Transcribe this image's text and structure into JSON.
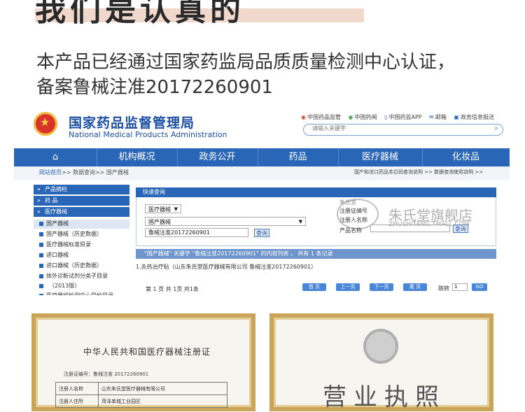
{
  "headline": "我们是认真的",
  "description": {
    "line1": "本产品已经通过国家药监局品质质量检测中心认证，",
    "line2": "备案鲁械注准20172260901"
  },
  "agency": {
    "name_cn": "国家药品监督管理局",
    "name_en": "National Medical Products Administration",
    "top_links": [
      "中国药品监管",
      "中国药闻",
      "中国药监APP",
      "邮箱",
      "政务信息报送"
    ],
    "search_placeholder": "请输入关键字"
  },
  "nav": {
    "items": [
      "机构概况",
      "政务公开",
      "药品",
      "医疗器械",
      "化妆品"
    ]
  },
  "breadcrumb": {
    "home": "网站首页",
    "rest": ">> 数据查询>> 国产器械"
  },
  "subnav_right": "国产和进口药品本位码查询说明 >>    数据查询使用说明 >>",
  "sidebar": {
    "heads": [
      "产品摘检",
      "药    品",
      "医疗器械"
    ],
    "items": [
      {
        "label": "国产器械",
        "active": true
      },
      {
        "label": "国产器械（历史数据）",
        "active": false
      },
      {
        "label": "医疗器械标准目录",
        "active": false
      },
      {
        "label": "进口器械",
        "active": false
      },
      {
        "label": "进口器械（历史数据）",
        "active": false
      },
      {
        "label": "体外诊断试剂分类子目录",
        "active": false
      },
      {
        "label": "（2013版）",
        "active": false
      },
      {
        "label": "医疗器械检测中心受检目录",
        "active": false
      }
    ]
  },
  "quick_search": {
    "title": "快速查询",
    "category_select": "医疗器械",
    "sub_select": "国产器械",
    "keyword_value": "鲁械注准20172260901",
    "search_button": "查询",
    "right_labels": [
      "注册证编号",
      "注册人名称",
      "产品名称"
    ],
    "right_search_button": "查询"
  },
  "watermark": {
    "shop": "朱氏堂旗舰店",
    "url": "ZHUSHITANG.TMALL.COM",
    "seal": "朱氏堂"
  },
  "result": {
    "summary": "\"国产器械\" 关键字 \"鲁械注准20172260901\" 的内容列表 ，  共有  1  条记录",
    "row": "1.灸热治疗贴（山东朱氏堂医疗器械有限公司 鲁械注准20172260901）",
    "pager_text": "第 1 页 共 1页 共1条",
    "buttons": [
      "首 页",
      "上一页",
      "下一页",
      "尾 页"
    ],
    "jump_label": "跳转",
    "jump_value": "1",
    "go_button": "GO"
  },
  "certificate": {
    "title": "中华人民共和国医疗器械注册证",
    "number_label": "注册证编号：鲁械注准 20172260901",
    "rows": [
      {
        "label": "注册人名称",
        "value": "山东朱氏堂医疗器械有限公司"
      },
      {
        "label": "注册人住所",
        "value": "菏泽单城工业园区"
      }
    ]
  },
  "license": {
    "title": "营业执照"
  },
  "colors": {
    "primary_blue": "#2a66b8",
    "frame_gold": "#c9a45a",
    "headline_highlight": "#f0d9cc"
  }
}
